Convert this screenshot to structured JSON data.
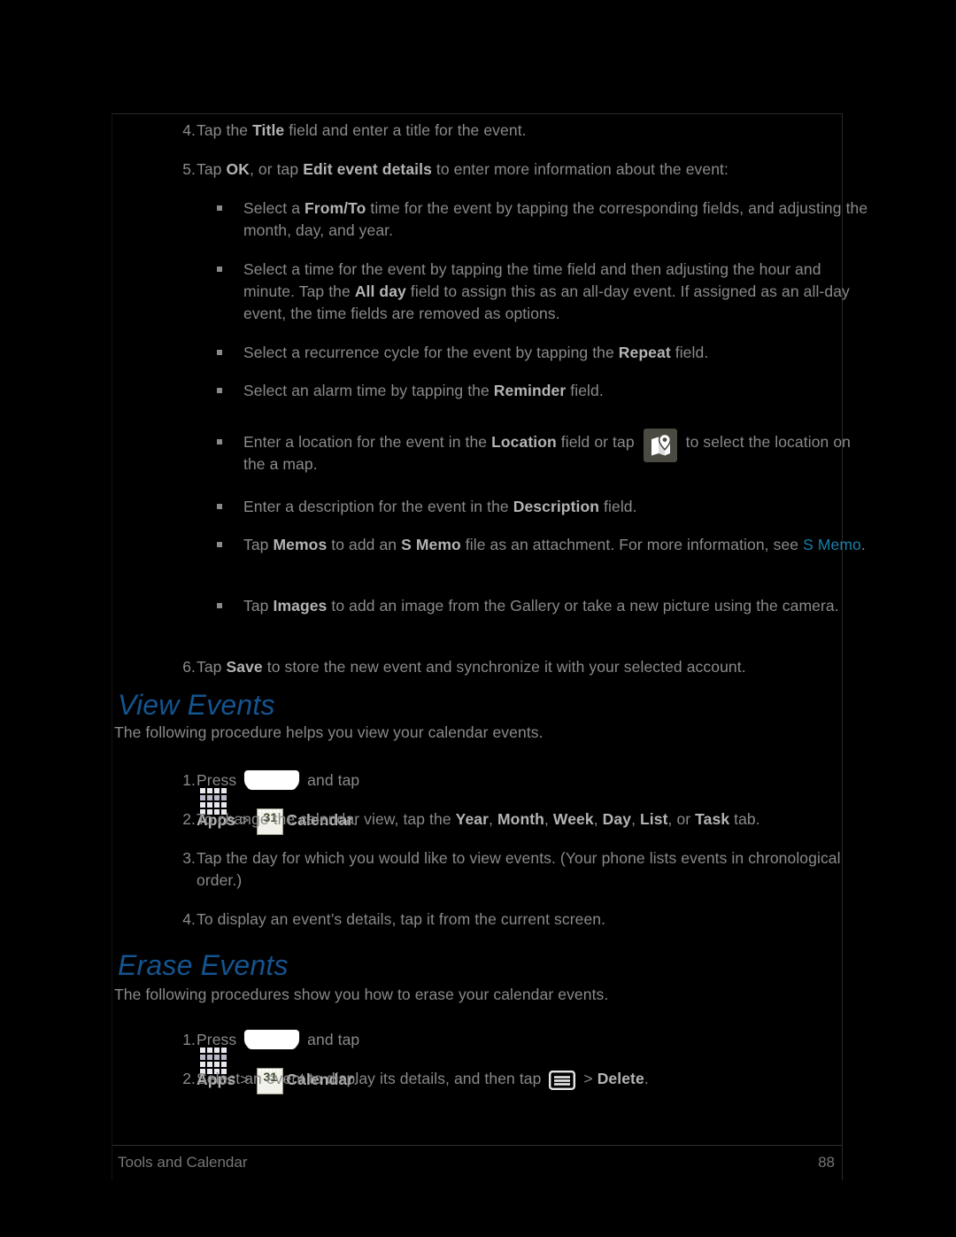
{
  "document": {
    "footer_left": "Tools and Calendar",
    "footer_page": "88"
  },
  "colors": {
    "background": "#000000",
    "body_text": "#8a8a8a",
    "bold_text": "#b4b4b4",
    "heading_blue": "#14548f",
    "link_blue": "#1a7fa8",
    "calendar_green": "#7cbf3f",
    "map_icon_bg": "#4a4a42"
  },
  "steps_create": [
    {
      "num": "4.",
      "parts": [
        {
          "t": "Tap the "
        },
        {
          "t": "Title",
          "b": true
        },
        {
          "t": " field and enter a title for the event."
        }
      ]
    },
    {
      "num": "5.",
      "parts": [
        {
          "t": "Tap "
        },
        {
          "t": "OK",
          "b": true
        },
        {
          "t": ", or tap "
        },
        {
          "t": "Edit event details",
          "b": true
        },
        {
          "t": " to enter more information about the event:"
        }
      ]
    }
  ],
  "bullets_create": [
    {
      "parts": [
        {
          "t": "Select a "
        },
        {
          "t": "From/To",
          "b": true
        },
        {
          "t": " time for the event by tapping the corresponding fields, and adjusting the month, day, and year."
        }
      ]
    },
    {
      "parts": [
        {
          "t": "Select a time for the event by tapping the time field and then adjusting the hour and minute. Tap the "
        },
        {
          "t": "All day",
          "b": true
        },
        {
          "t": " field to assign this as an all-day event. If assigned as an all-day event, the time fields are removed as options."
        }
      ]
    },
    {
      "parts": [
        {
          "t": "Select a recurrence cycle for the event by tapping the "
        },
        {
          "t": "Repeat",
          "b": true
        },
        {
          "t": " field."
        }
      ]
    },
    {
      "parts": [
        {
          "t": "Select an alarm time by tapping the "
        },
        {
          "t": "Reminder",
          "b": true
        },
        {
          "t": " field."
        }
      ]
    },
    {
      "parts": [
        {
          "t": "Enter a location for the event in the "
        },
        {
          "t": "Location",
          "b": true
        },
        {
          "t": " field or tap "
        },
        {
          "icon": "map-location-icon"
        },
        {
          "t": " to select the location on the a map."
        }
      ]
    },
    {
      "parts": [
        {
          "t": "Enter a description for the event in the "
        },
        {
          "t": "Description",
          "b": true
        },
        {
          "t": " field."
        }
      ]
    },
    {
      "parts": [
        {
          "t": "Tap "
        },
        {
          "t": "Memos",
          "b": true
        },
        {
          "t": " to add an "
        },
        {
          "t": "S Memo",
          "b": true
        },
        {
          "t": " file as an attachment. For more information, see "
        },
        {
          "t": "S Memo",
          "link": true
        },
        {
          "t": "."
        }
      ]
    },
    {
      "parts": [
        {
          "t": "Tap "
        },
        {
          "t": "Images",
          "b": true
        },
        {
          "t": " to add an image from the Gallery or take a new picture using the camera."
        }
      ]
    }
  ],
  "step_save": {
    "num": "6.",
    "parts": [
      {
        "t": "Tap "
      },
      {
        "t": "Save",
        "b": true
      },
      {
        "t": " to store the new event and synchronize it with your selected account."
      }
    ]
  },
  "view_events": {
    "heading": "View Events",
    "intro": "The following procedure helps you view your calendar events.",
    "steps": [
      {
        "num": "1.",
        "parts": [
          {
            "t": "Press "
          },
          {
            "icon": "home-key-icon"
          },
          {
            "t": " and tap "
          },
          {
            "icon": "apps-grid-icon"
          },
          {
            "t": "Apps",
            "b": true
          },
          {
            "t": " > "
          },
          {
            "icon": "calendar-icon"
          },
          {
            "t": "Calendar",
            "b": true
          },
          {
            "t": "."
          }
        ]
      },
      {
        "num": "2.",
        "parts": [
          {
            "t": "To change the calendar view, tap the "
          },
          {
            "t": "Year",
            "b": true
          },
          {
            "t": ", "
          },
          {
            "t": "Month",
            "b": true
          },
          {
            "t": ", "
          },
          {
            "t": "Week",
            "b": true
          },
          {
            "t": ", "
          },
          {
            "t": "Day",
            "b": true
          },
          {
            "t": ", "
          },
          {
            "t": "List",
            "b": true
          },
          {
            "t": ", or "
          },
          {
            "t": "Task",
            "b": true
          },
          {
            "t": " tab."
          }
        ]
      },
      {
        "num": "3.",
        "parts": [
          {
            "t": "Tap the day for which you would like to view events. (Your phone lists events in chronological order.)"
          }
        ]
      },
      {
        "num": "4.",
        "parts": [
          {
            "t": "To display an event’s details, tap it from the current screen."
          }
        ]
      }
    ]
  },
  "erase_events": {
    "heading": "Erase Events",
    "intro": "The following procedures show you how to erase your calendar events.",
    "steps": [
      {
        "num": "1.",
        "parts": [
          {
            "t": "Press "
          },
          {
            "icon": "home-key-icon"
          },
          {
            "t": " and tap "
          },
          {
            "icon": "apps-grid-icon"
          },
          {
            "t": "Apps",
            "b": true
          },
          {
            "t": " > "
          },
          {
            "icon": "calendar-icon"
          },
          {
            "t": "Calendar",
            "b": true
          },
          {
            "t": "."
          }
        ]
      },
      {
        "num": "2.",
        "parts": [
          {
            "t": "Select an event to display its details, and then tap "
          },
          {
            "icon": "menu-icon"
          },
          {
            "t": " > "
          },
          {
            "t": "Delete",
            "b": true
          },
          {
            "t": "."
          }
        ]
      }
    ]
  },
  "icons": {
    "calendar_day_number": "31",
    "home_key": "home-key-icon",
    "apps_grid": "apps-grid-icon",
    "calendar": "calendar-icon",
    "map_location": "map-location-icon",
    "menu": "menu-icon"
  }
}
